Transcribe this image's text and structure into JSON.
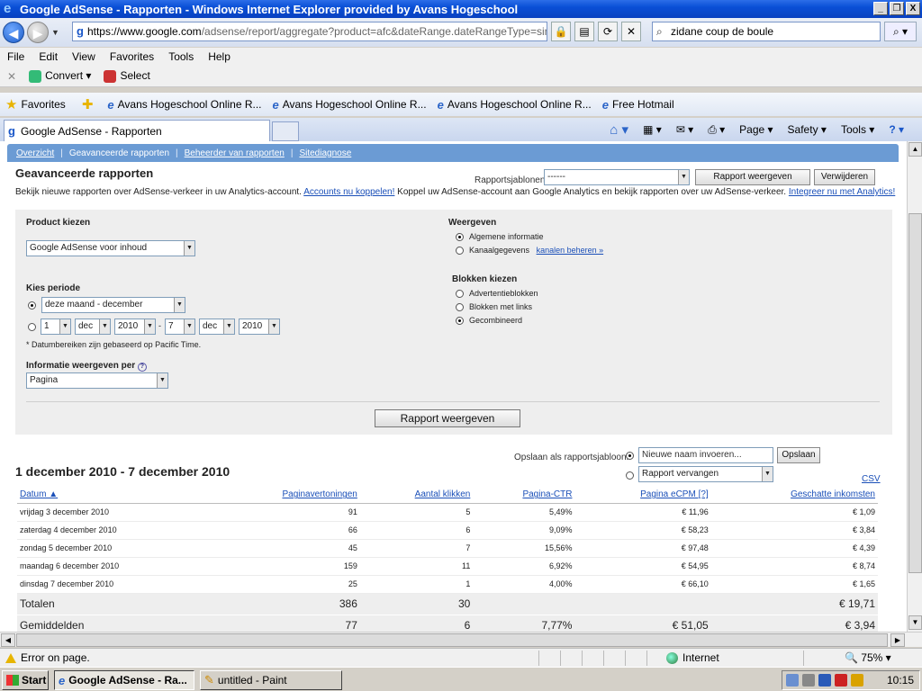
{
  "window": {
    "title": "Google AdSense - Rapporten - Windows Internet Explorer provided by Avans Hogeschool",
    "controls": [
      "_",
      "❐",
      "X"
    ]
  },
  "address": {
    "url_host": "https://www.google.com",
    "url_rest": "/adsense/report/aggregate?product=afc&dateRange.dateRangeType=simp",
    "search_value": "zidane coup de boule"
  },
  "menu": [
    "File",
    "Edit",
    "View",
    "Favorites",
    "Tools",
    "Help"
  ],
  "commandbar": {
    "convert": "Convert",
    "select": "Select"
  },
  "favorites": {
    "label": "Favorites",
    "items": [
      "Avans Hogeschool Online R...",
      "Avans Hogeschool Online R...",
      "Avans Hogeschool Online R...",
      "Free Hotmail"
    ]
  },
  "tab": {
    "title": "Google AdSense - Rapporten",
    "tools": [
      "Page",
      "Safety",
      "Tools"
    ]
  },
  "subnav": {
    "items": [
      "Overzicht",
      "Geavanceerde rapporten",
      "Beheerder van rapporten",
      "Sitediagnose"
    ],
    "sep": "|"
  },
  "page": {
    "title": "Geavanceerde rapporten",
    "templates_label": "Rapportsjablonen:",
    "templates_value": "------",
    "show_report_btn": "Rapport weergeven",
    "delete_btn": "Verwijderen",
    "intro_1": "Bekijk nieuwe rapporten over AdSense-verkeer in uw Analytics-account.",
    "intro_link_1": "Accounts nu koppelen!",
    "intro_2": "Koppel uw AdSense-account aan Google Analytics en bekijk rapporten over uw AdSense-verkeer.",
    "intro_link_2": "Integreer nu met Analytics!"
  },
  "form": {
    "product_label": "Product kiezen",
    "product_value": "Google AdSense voor inhoud",
    "period_label": "Kies periode",
    "period_value": "deze maand - december",
    "date_from_day": "1",
    "date_from_month": "dec",
    "date_from_year": "2010",
    "dash": "-",
    "date_to_day": "7",
    "date_to_month": "dec",
    "date_to_year": "2010",
    "timezone_note": "* Datumbereiken zijn gebaseerd op Pacific Time.",
    "perunit_label": "Informatie weergeven per",
    "perunit_value": "Pagina",
    "help_glyph": "?",
    "weergeven_label": "Weergeven",
    "opt_general": "Algemene informatie",
    "opt_channel": "Kanaalgegevens",
    "channel_link": "kanalen beheren »",
    "blocks_label": "Blokken kiezen",
    "opt_ads": "Advertentieblokken",
    "opt_links": "Blokken met links",
    "opt_combined": "Gecombineerd",
    "submit_btn": "Rapport weergeven"
  },
  "results": {
    "range": "1 december 2010 - 7 december 2010",
    "save_label": "Opslaan als rapportsjabloon:",
    "save_input": "Nieuwe naam invoeren...",
    "save_btn": "Opslaan",
    "replace_value": "Rapport vervangen",
    "csv": "CSV",
    "columns": [
      "Datum ▲",
      "Paginavertoningen",
      "Aantal klikken",
      "Pagina-CTR",
      "Pagina eCPM [?]",
      "Geschatte inkomsten"
    ],
    "rows": [
      [
        "vrijdag 3 december 2010",
        "91",
        "5",
        "5,49%",
        "€ 11,96",
        "€ 1,09"
      ],
      [
        "zaterdag 4 december 2010",
        "66",
        "6",
        "9,09%",
        "€ 58,23",
        "€ 3,84"
      ],
      [
        "zondag 5 december 2010",
        "45",
        "7",
        "15,56%",
        "€ 97,48",
        "€ 4,39"
      ],
      [
        "maandag 6 december 2010",
        "159",
        "11",
        "6,92%",
        "€ 54,95",
        "€ 8,74"
      ],
      [
        "dinsdag 7 december 2010",
        "25",
        "1",
        "4,00%",
        "€ 66,10",
        "€ 1,65"
      ]
    ],
    "totals": [
      "Totalen",
      "386",
      "30",
      "",
      "",
      "€ 19,71"
    ],
    "averages": [
      "Gemiddelden",
      "77",
      "6",
      "7,77%",
      "€ 51,05",
      "€ 3,94"
    ]
  },
  "statusbar": {
    "message": "Error on page.",
    "zone": "Internet",
    "zoom": "75%"
  },
  "taskbar": {
    "start": "Start",
    "items": [
      "Google AdSense - Ra...",
      "untitled - Paint"
    ],
    "clock": "10:15"
  }
}
